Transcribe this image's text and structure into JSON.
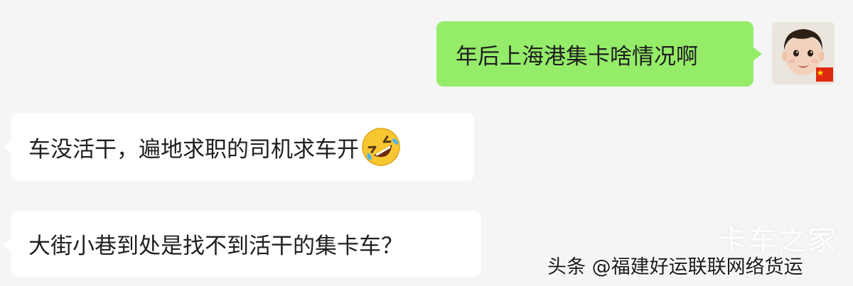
{
  "messages": [
    {
      "sender": "self",
      "text": "年后上海港集卡啥情况啊"
    },
    {
      "sender": "other",
      "text": "车没活干，遍地求职的司机求车开",
      "emoji": "rolling-on-floor-laughing-emoji"
    },
    {
      "sender": "other",
      "text": "大街小巷到处是找不到活干的集卡车？"
    }
  ],
  "watermark": "卡车之家",
  "source_label": "头条 @福建好运联联网络货运",
  "colors": {
    "background": "#f5f5f5",
    "sent_bubble": "#95ec69",
    "received_bubble": "#ffffff"
  }
}
